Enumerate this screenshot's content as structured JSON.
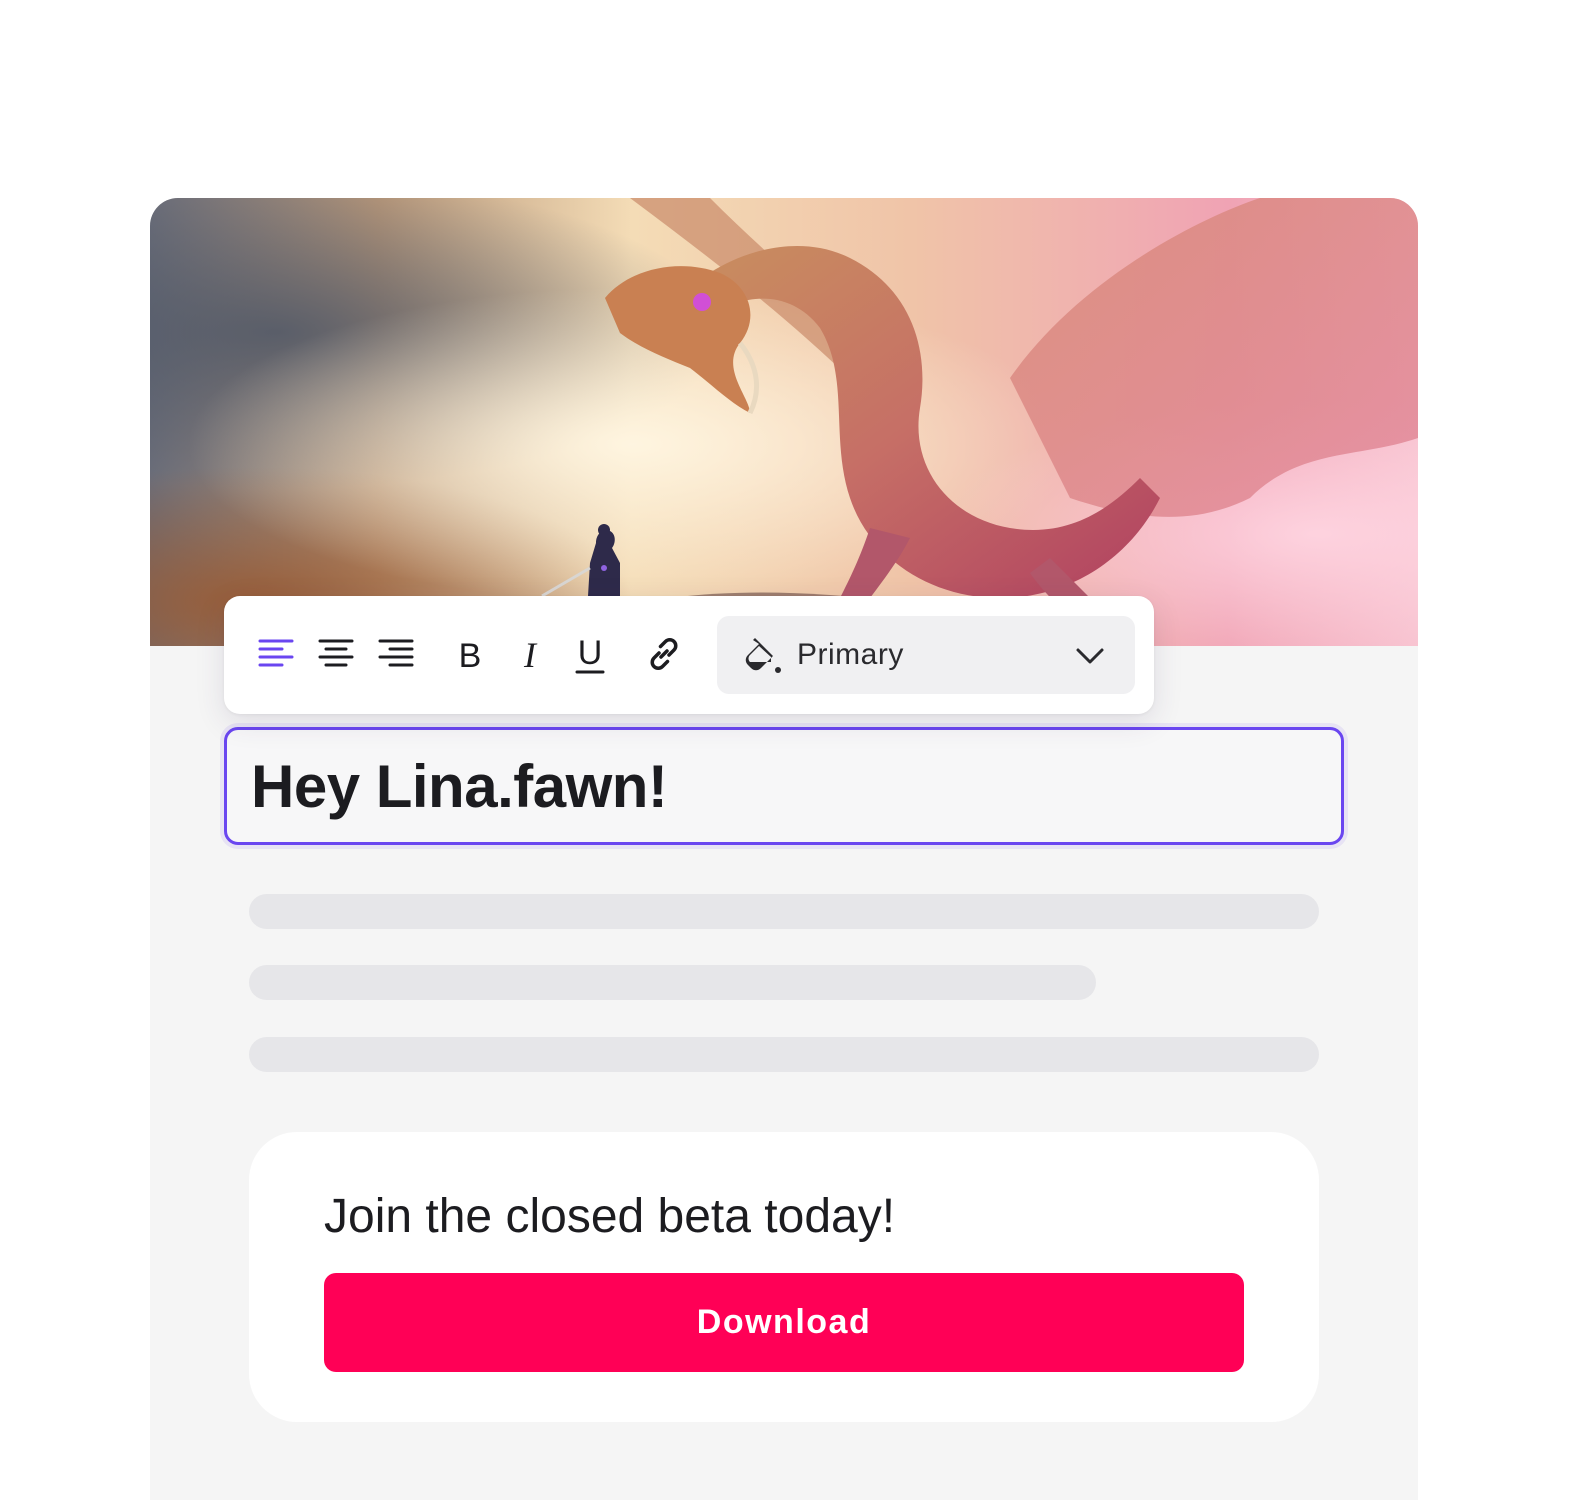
{
  "hero": {
    "image_subject": "dragon-and-knight-illustration"
  },
  "toolbar": {
    "buttons": [
      {
        "name": "align-left",
        "icon": "align-left-icon",
        "active": true
      },
      {
        "name": "align-center",
        "icon": "align-center-icon",
        "active": false
      },
      {
        "name": "align-right",
        "icon": "align-right-icon",
        "active": false
      },
      {
        "name": "bold",
        "icon": "bold-icon",
        "glyph": "B"
      },
      {
        "name": "italic",
        "icon": "italic-icon",
        "glyph": "I"
      },
      {
        "name": "underline",
        "icon": "underline-icon",
        "glyph": "U"
      },
      {
        "name": "link",
        "icon": "link-icon"
      }
    ],
    "color_select": {
      "icon": "paint-bucket-icon",
      "value": "Primary",
      "chevron": "chevron-down-icon"
    }
  },
  "editor": {
    "headline": "Hey Lina.fawn!"
  },
  "cta": {
    "title": "Join the closed beta today!",
    "button_label": "Download"
  },
  "colors": {
    "accent": "#6a46f0",
    "button": "#ff0056",
    "card_background": "#f5f5f5",
    "skeleton": "#e6e6e9",
    "text": "#1c1c20"
  }
}
